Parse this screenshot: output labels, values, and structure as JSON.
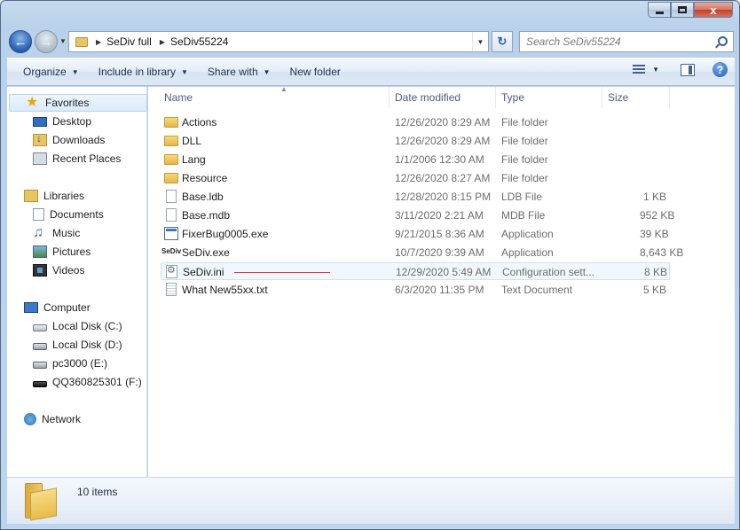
{
  "window": {
    "caption": {
      "minimize": "",
      "maximize": "",
      "close": "x"
    }
  },
  "nav": {
    "back_icon": "back-arrow-icon",
    "forward_icon": "forward-arrow-icon",
    "breadcrumbs": [
      "SeDiv full",
      "SeDiv55224"
    ],
    "search_placeholder": "Search SeDiv55224"
  },
  "toolbar": {
    "organize": "Organize",
    "include_in_library": "Include in library",
    "share_with": "Share with",
    "new_folder": "New folder",
    "help": "?"
  },
  "sidebar": {
    "favorites": {
      "label": "Favorites",
      "items": [
        {
          "label": "Desktop",
          "icon": "desktop-icon"
        },
        {
          "label": "Downloads",
          "icon": "downloads-icon"
        },
        {
          "label": "Recent Places",
          "icon": "recent-places-icon"
        }
      ]
    },
    "libraries": {
      "label": "Libraries",
      "items": [
        {
          "label": "Documents",
          "icon": "documents-icon"
        },
        {
          "label": "Music",
          "icon": "music-icon"
        },
        {
          "label": "Pictures",
          "icon": "pictures-icon"
        },
        {
          "label": "Videos",
          "icon": "videos-icon"
        }
      ]
    },
    "computer": {
      "label": "Computer",
      "items": [
        {
          "label": "Local Disk (C:)",
          "icon": "drive-icon"
        },
        {
          "label": "Local Disk (D:)",
          "icon": "drive-icon"
        },
        {
          "label": "pc3000 (E:)",
          "icon": "drive-icon"
        },
        {
          "label": "QQ360825301 (F:)",
          "icon": "usb-drive-icon"
        }
      ]
    },
    "network": {
      "label": "Network"
    }
  },
  "columns": {
    "name": "Name",
    "date": "Date modified",
    "type": "Type",
    "size": "Size"
  },
  "files": [
    {
      "name": "Actions",
      "date": "12/26/2020 8:29 AM",
      "type": "File folder",
      "size": "",
      "icon": "folder-icon"
    },
    {
      "name": "DLL",
      "date": "12/26/2020 8:29 AM",
      "type": "File folder",
      "size": "",
      "icon": "folder-icon"
    },
    {
      "name": "Lang",
      "date": "1/1/2006 12:30 AM",
      "type": "File folder",
      "size": "",
      "icon": "folder-icon"
    },
    {
      "name": "Resource",
      "date": "12/26/2020 8:27 AM",
      "type": "File folder",
      "size": "",
      "icon": "folder-icon"
    },
    {
      "name": "Base.ldb",
      "date": "12/28/2020 8:15 PM",
      "type": "LDB File",
      "size": "1 KB",
      "icon": "file-icon"
    },
    {
      "name": "Base.mdb",
      "date": "3/11/2020 2:21 AM",
      "type": "MDB File",
      "size": "952 KB",
      "icon": "file-icon"
    },
    {
      "name": "FixerBug0005.exe",
      "date": "9/21/2015 8:36 AM",
      "type": "Application",
      "size": "39 KB",
      "icon": "application-icon"
    },
    {
      "name": "SeDiv.exe",
      "date": "10/7/2020 9:39 AM",
      "type": "Application",
      "size": "8,643 KB",
      "icon": "sediv-app-icon",
      "icon_text": "SeDiv"
    },
    {
      "name": "SeDiv.ini",
      "date": "12/29/2020 5:49 AM",
      "type": "Configuration sett...",
      "size": "8 KB",
      "icon": "settings-file-icon"
    },
    {
      "name": "What New55xx.txt",
      "date": "6/3/2020 11:35 PM",
      "type": "Text Document",
      "size": "5 KB",
      "icon": "text-file-icon"
    }
  ],
  "details": {
    "count": "10 items"
  },
  "colors": {
    "annotation_line": "#d83a3a",
    "selection": "#cfe1f5"
  }
}
